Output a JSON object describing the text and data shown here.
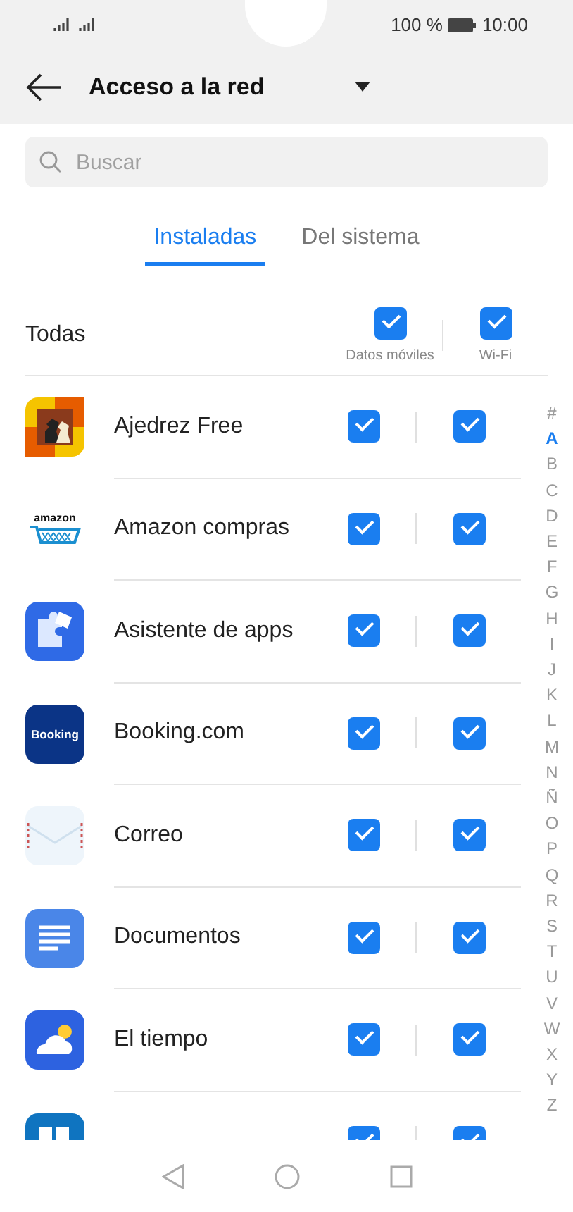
{
  "status_bar": {
    "battery": "100 %",
    "time": "10:00"
  },
  "header": {
    "title": "Acceso a la red"
  },
  "search": {
    "placeholder": "Buscar"
  },
  "tabs": [
    {
      "label": "Instaladas",
      "selected": true
    },
    {
      "label": "Del sistema",
      "selected": false
    }
  ],
  "all_row": {
    "label": "Todas",
    "mobile_data": {
      "label": "Datos móviles",
      "checked": true
    },
    "wifi": {
      "label": "Wi-Fi",
      "checked": true
    }
  },
  "apps": [
    {
      "name": "Ajedrez Free",
      "kind": "chess",
      "mobile_data": true,
      "wifi": true
    },
    {
      "name": "Amazon compras",
      "kind": "amazon",
      "logo_text": "amazon",
      "mobile_data": true,
      "wifi": true
    },
    {
      "name": "Asistente de apps",
      "kind": "puzzle",
      "mobile_data": true,
      "wifi": true
    },
    {
      "name": "Booking.com",
      "kind": "booking",
      "logo_text": "Booking",
      "mobile_data": true,
      "wifi": true
    },
    {
      "name": "Correo",
      "kind": "mail",
      "mobile_data": true,
      "wifi": true
    },
    {
      "name": "Documentos",
      "kind": "docs",
      "mobile_data": true,
      "wifi": true
    },
    {
      "name": "El tiempo",
      "kind": "weather",
      "mobile_data": true,
      "wifi": true
    },
    {
      "kind": "tiles",
      "mobile_data": true,
      "wifi": true
    }
  ],
  "index": [
    {
      "label": "#",
      "selected": false
    },
    {
      "label": "A",
      "selected": true
    },
    {
      "label": "B",
      "selected": false
    },
    {
      "label": "C",
      "selected": false
    },
    {
      "label": "D",
      "selected": false
    },
    {
      "label": "E",
      "selected": false
    },
    {
      "label": "F",
      "selected": false
    },
    {
      "label": "G",
      "selected": false
    },
    {
      "label": "H",
      "selected": false
    },
    {
      "label": "I",
      "selected": false
    },
    {
      "label": "J",
      "selected": false
    },
    {
      "label": "K",
      "selected": false
    },
    {
      "label": "L",
      "selected": false
    },
    {
      "label": "M",
      "selected": false
    },
    {
      "label": "N",
      "selected": false
    },
    {
      "label": "Ñ",
      "selected": false
    },
    {
      "label": "O",
      "selected": false
    },
    {
      "label": "P",
      "selected": false
    },
    {
      "label": "Q",
      "selected": false
    },
    {
      "label": "R",
      "selected": false
    },
    {
      "label": "S",
      "selected": false
    },
    {
      "label": "T",
      "selected": false
    },
    {
      "label": "U",
      "selected": false
    },
    {
      "label": "V",
      "selected": false
    },
    {
      "label": "W",
      "selected": false
    },
    {
      "label": "X",
      "selected": false
    },
    {
      "label": "Y",
      "selected": false
    },
    {
      "label": "Z",
      "selected": false
    }
  ]
}
